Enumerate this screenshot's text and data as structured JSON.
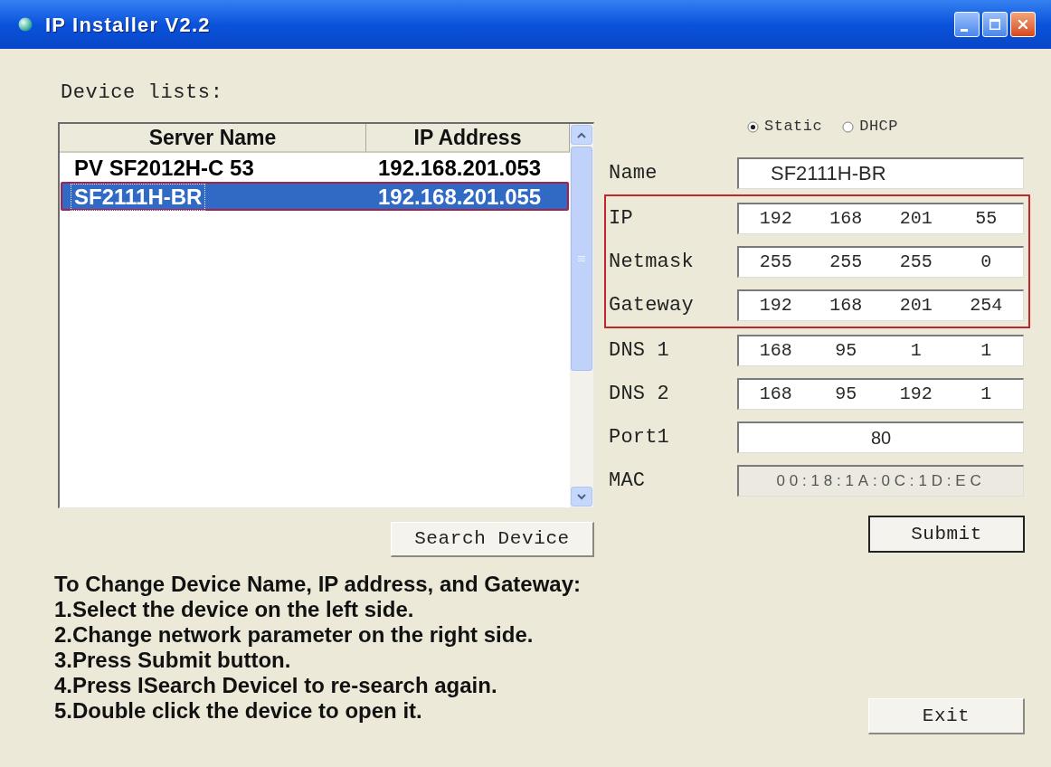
{
  "window": {
    "title": "IP Installer V2.2"
  },
  "device_list": {
    "label": "Device lists:",
    "columns": [
      "Server Name",
      "IP Address"
    ],
    "rows": [
      {
        "cells": [
          "PV SF2012H-C 53",
          "192.168.201.053"
        ],
        "selected": false,
        "annotated": false
      },
      {
        "cells": [
          "SF2111H-BR",
          "192.168.201.055"
        ],
        "selected": true,
        "annotated": true
      }
    ]
  },
  "search_button": "Search Device",
  "instructions": [
    "To Change Device Name, IP address, and Gateway:",
    "1.Select the device on the left side.",
    "2.Change network parameter on the right side.",
    "3.Press Submit button.",
    "4.Press ISearch DeviceI to re-search again.",
    "5.Double click the device to open it."
  ],
  "address_mode": [
    {
      "label": "Static",
      "selected": true
    },
    {
      "label": "DHCP",
      "selected": false
    }
  ],
  "fields": [
    {
      "kind": "text",
      "label": "Name",
      "value": "SF2111H-BR",
      "disabled": false,
      "annotated": false
    },
    {
      "kind": "octets",
      "label": "IP",
      "octets": [
        "192",
        "168",
        "201",
        "55"
      ],
      "disabled": false,
      "annotated": true
    },
    {
      "kind": "octets",
      "label": "Netmask",
      "octets": [
        "255",
        "255",
        "255",
        "0"
      ],
      "disabled": false,
      "annotated": true
    },
    {
      "kind": "octets",
      "label": "Gateway",
      "octets": [
        "192",
        "168",
        "201",
        "254"
      ],
      "disabled": false,
      "annotated": true
    },
    {
      "kind": "octets",
      "label": "DNS 1",
      "octets": [
        "168",
        "95",
        "1",
        "1"
      ],
      "disabled": false,
      "annotated": false
    },
    {
      "kind": "octets",
      "label": "DNS 2",
      "octets": [
        "168",
        "95",
        "192",
        "1"
      ],
      "disabled": false,
      "annotated": false
    },
    {
      "kind": "port",
      "label": "Port1",
      "value": "80",
      "disabled": false,
      "annotated": false
    },
    {
      "kind": "mac",
      "label": "MAC",
      "value": "00:18:1A:0C:1D:EC",
      "disabled": true,
      "annotated": false
    }
  ],
  "submit_button": "Submit",
  "exit_button": "Exit"
}
